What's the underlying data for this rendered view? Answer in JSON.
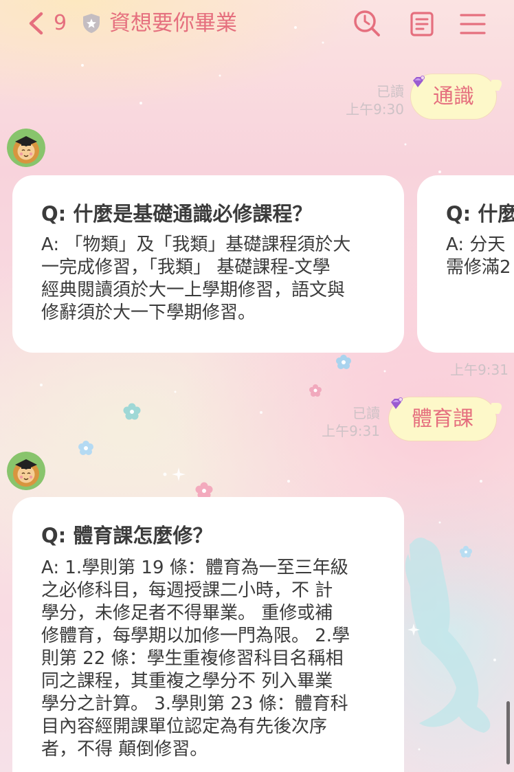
{
  "header": {
    "unread_count": "9",
    "title": "資想要你畢業"
  },
  "icons": {
    "back": "chevron-left-icon",
    "badge": "shield-star-icon",
    "search": "search-clock-icon",
    "notes": "notes-icon",
    "menu": "menu-icon",
    "avatar": "mascot-avatar",
    "sticker": "gem-sticker-icon"
  },
  "colors": {
    "accent": "#e56f7e",
    "bubble": "#fdf8c9",
    "card": "#ffffff",
    "card_text": "#3b3b3b",
    "meta": "#cdc2c6"
  },
  "chat": {
    "msg_1": {
      "text": "通識",
      "read_label": "已讀",
      "time": "上午9:30"
    },
    "reply_1": {
      "cards": [
        {
          "question": "Q: 什麼是基礎通識必修課程？",
          "answer_lines": [
            "A: 「物類」及「我類」基礎課程須於大",
            "一完成修習，「我類」 基礎課程-文學",
            "經典閱讀須於大一上學期修習，語文與",
            "修辭須於大一下學期修習。"
          ]
        },
        {
          "question": "Q: 什麼",
          "answer_lines": [
            "A: 分天",
            "需修滿2"
          ]
        }
      ],
      "time": "上午9:31"
    },
    "msg_2": {
      "text": "體育課",
      "read_label": "已讀",
      "time": "上午9:31"
    },
    "reply_2": {
      "cards": [
        {
          "question": "Q: 體育課怎麼修？",
          "answer_lines": [
            "A: 1.學則第 19 條：體育為一至三年級",
            "之必修科目，每週授課二小時，不 計",
            "學分，未修足者不得畢業。 重修或補",
            "修體育，每學期以加修一門為限。 2.學",
            "則第 22 條：學生重複修習科目名稱相",
            "同之課程，其重複之學分不 列入畢業",
            "學分之計算。 3.學則第 23 條：體育科",
            "目內容經開課單位認定為有先後次序",
            "者，不得 顛倒修習。"
          ]
        }
      ]
    }
  }
}
